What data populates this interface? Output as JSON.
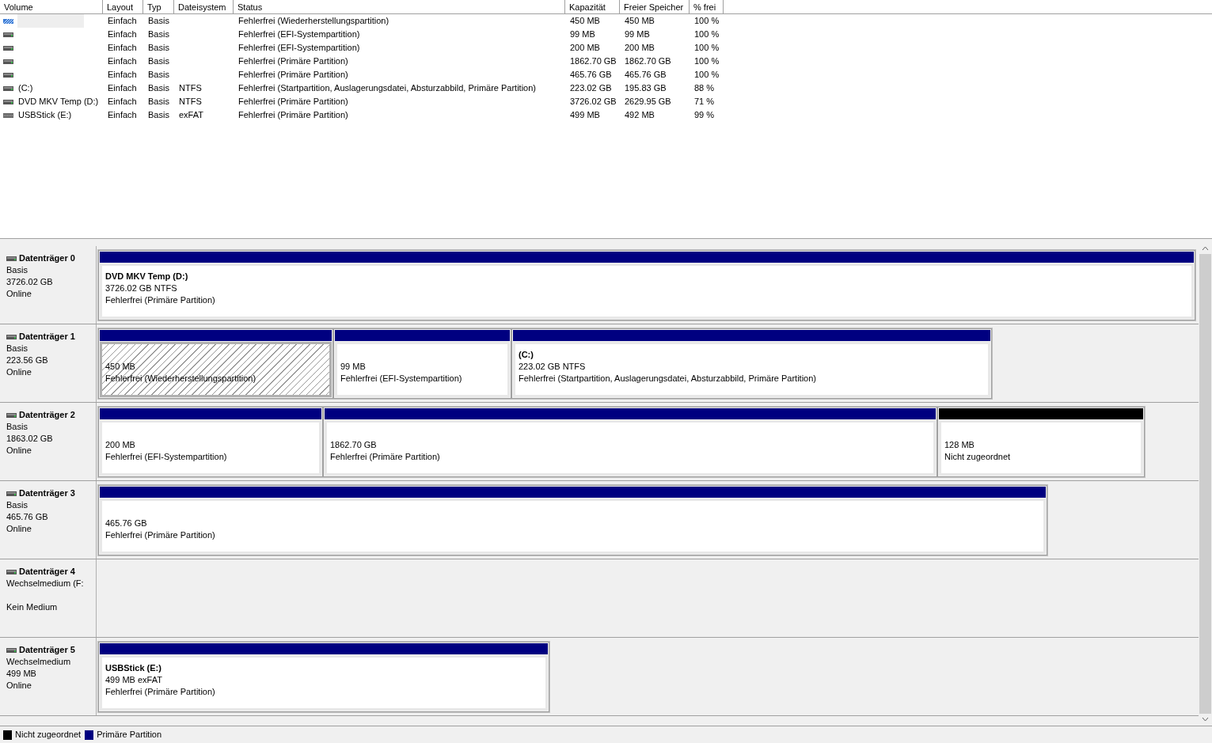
{
  "volume_table": {
    "columns": [
      "Volume",
      "Layout",
      "Typ",
      "Dateisystem",
      "Status",
      "Kapazität",
      "Freier Speicher",
      "% frei"
    ],
    "rows": [
      {
        "kind": "recovery",
        "selected": true,
        "cells": [
          "",
          "Einfach",
          "Basis",
          "",
          "Fehlerfrei (Wiederherstellungspartition)",
          "450 MB",
          "450 MB",
          "100 %"
        ]
      },
      {
        "kind": "basic",
        "selected": false,
        "cells": [
          "",
          "Einfach",
          "Basis",
          "",
          "Fehlerfrei (EFI-Systempartition)",
          "99 MB",
          "99 MB",
          "100 %"
        ]
      },
      {
        "kind": "basic",
        "selected": false,
        "cells": [
          "",
          "Einfach",
          "Basis",
          "",
          "Fehlerfrei (EFI-Systempartition)",
          "200 MB",
          "200 MB",
          "100 %"
        ]
      },
      {
        "kind": "basic",
        "selected": false,
        "cells": [
          "",
          "Einfach",
          "Basis",
          "",
          "Fehlerfrei (Primäre Partition)",
          "1862.70 GB",
          "1862.70 GB",
          "100 %"
        ]
      },
      {
        "kind": "basic",
        "selected": false,
        "cells": [
          "",
          "Einfach",
          "Basis",
          "",
          "Fehlerfrei (Primäre Partition)",
          "465.76 GB",
          "465.76 GB",
          "100 %"
        ]
      },
      {
        "kind": "basic",
        "selected": false,
        "cells": [
          "(C:)",
          "Einfach",
          "Basis",
          "NTFS",
          "Fehlerfrei (Startpartition, Auslagerungsdatei, Absturzabbild, Primäre Partition)",
          "223.02 GB",
          "195.83 GB",
          "88 %"
        ]
      },
      {
        "kind": "basic",
        "selected": false,
        "cells": [
          "DVD MKV Temp (D:)",
          "Einfach",
          "Basis",
          "NTFS",
          "Fehlerfrei (Primäre Partition)",
          "3726.02 GB",
          "2629.95 GB",
          "71 %"
        ]
      },
      {
        "kind": "removable",
        "selected": false,
        "cells": [
          "USBStick (E:)",
          "Einfach",
          "Basis",
          "exFAT",
          "Fehlerfrei (Primäre Partition)",
          "499 MB",
          "492 MB",
          "99 %"
        ]
      }
    ]
  },
  "disks": [
    {
      "name": "Datenträger 0",
      "type": "Basis",
      "size": "3726.02 GB",
      "status": "Online",
      "partitions": [
        {
          "kind": "primary",
          "selected": false,
          "name": "DVD MKV Temp  (D:)",
          "size": "3726.02 GB NTFS",
          "status": "Fehlerfrei (Primäre Partition)"
        }
      ]
    },
    {
      "name": "Datenträger 1",
      "type": "Basis",
      "size": "223.56 GB",
      "status": "Online",
      "partitions": [
        {
          "kind": "primary",
          "selected": true,
          "size": "450 MB",
          "status": "Fehlerfrei (Wiederherstellungspartition)"
        },
        {
          "kind": "primary",
          "selected": false,
          "size": "99 MB",
          "status": "Fehlerfrei (EFI-Systempartition)"
        },
        {
          "kind": "primary",
          "selected": false,
          "name": "(C:)",
          "size": "223.02 GB NTFS",
          "status": "Fehlerfrei (Startpartition, Auslagerungsdatei, Absturzabbild, Primäre Partition)"
        }
      ]
    },
    {
      "name": "Datenträger 2",
      "type": "Basis",
      "size": "1863.02 GB",
      "status": "Online",
      "partitions": [
        {
          "kind": "primary",
          "selected": false,
          "size": "200 MB",
          "status": "Fehlerfrei (EFI-Systempartition)"
        },
        {
          "kind": "primary",
          "selected": false,
          "size": "1862.70 GB",
          "status": "Fehlerfrei (Primäre Partition)"
        },
        {
          "kind": "unallocated",
          "selected": false,
          "size": "128 MB",
          "status": "Nicht zugeordnet"
        }
      ]
    },
    {
      "name": "Datenträger 3",
      "type": "Basis",
      "size": "465.76 GB",
      "status": "Online",
      "partitions": [
        {
          "kind": "primary",
          "selected": false,
          "size": "465.76 GB",
          "status": "Fehlerfrei (Primäre Partition)"
        }
      ]
    },
    {
      "name": "Datenträger 4",
      "type": "Wechselmedium (F:",
      "status": "Kein Medium"
    },
    {
      "name": "Datenträger 5",
      "type": "Wechselmedium",
      "size": "499 MB",
      "status": "Online",
      "partitions": [
        {
          "kind": "primary",
          "selected": false,
          "name": "USBStick  (E:)",
          "size": "499 MB exFAT",
          "status": "Fehlerfrei (Primäre Partition)"
        }
      ]
    }
  ],
  "legend": [
    {
      "label": "Nicht zugeordnet",
      "color": "#000000"
    },
    {
      "label": "Primäre Partition",
      "color": "#000080"
    }
  ]
}
